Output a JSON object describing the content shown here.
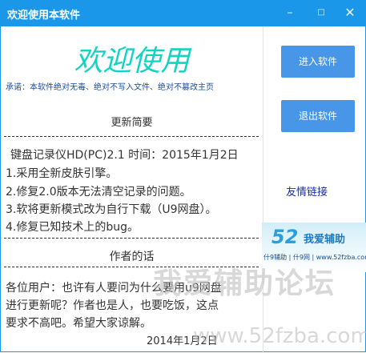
{
  "window": {
    "title": "欢迎使用本软件",
    "min": "–",
    "max": "□",
    "close": "✕"
  },
  "welcome": "欢迎使用",
  "promise": "承诺：本软件绝对无毒、绝对不写入文件、绝对不篡改主页",
  "update": {
    "title": "更新简要",
    "dashes": "-------------------------------------------------------------------",
    "lines": [
      "键盘记录仪HD(PC)2.1 时间：2015年1月2日",
      "1.采用全新皮肤引擎。",
      "2.修复2.0版本无法清空记录的问题。",
      "3.软将更新模式改为自行下载（U9网盘）。",
      "4.修复已知技术上的bug。"
    ]
  },
  "author": {
    "title": "作者的话",
    "lines": [
      "各位用户：也许有人要问为什么要用u9网盘",
      "进行更新呢？作者也是人，也要吃饭，这点",
      "要求不高吧。希望大家谅解。"
    ],
    "date": "2014年1月2日"
  },
  "side": {
    "enter_button": "进入软件",
    "exit_button": "退出软件",
    "friend_link": "友情链接",
    "banner": {
      "number": "52",
      "name": "我爱辅助",
      "sub": "什9辅助 | 什9网 | www.52fzba.com"
    }
  },
  "watermark": {
    "line1": "我爱辅助论坛",
    "line2": "www.52fzba.com"
  },
  "colors": {
    "titlebar": "#1a97e8",
    "button": "#4896e8",
    "welcome": "#12d4c3"
  }
}
